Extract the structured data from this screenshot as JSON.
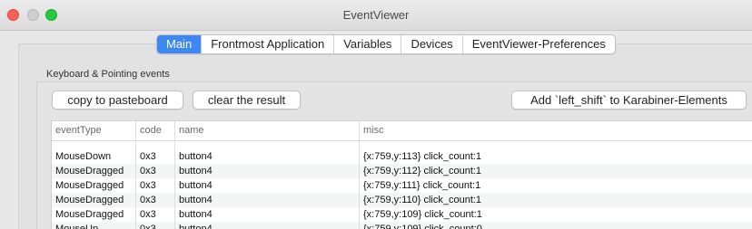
{
  "window": {
    "title": "EventViewer"
  },
  "tabs": [
    {
      "label": "Main",
      "active": true
    },
    {
      "label": "Frontmost Application",
      "active": false
    },
    {
      "label": "Variables",
      "active": false
    },
    {
      "label": "Devices",
      "active": false
    },
    {
      "label": "EventViewer-Preferences",
      "active": false
    }
  ],
  "group": {
    "label": "Keyboard & Pointing events"
  },
  "buttons": {
    "copy": "copy to pasteboard",
    "clear": "clear the result",
    "add": "Add `left_shift` to Karabiner-Elements"
  },
  "table": {
    "columns": [
      "eventType",
      "code",
      "name",
      "misc"
    ],
    "rows": [
      [
        "MouseDown",
        "0x3",
        "button4",
        "{x:759,y:113} click_count:1"
      ],
      [
        "MouseDragged",
        "0x3",
        "button4",
        "{x:759,y:112} click_count:1"
      ],
      [
        "MouseDragged",
        "0x3",
        "button4",
        "{x:759,y:111} click_count:1"
      ],
      [
        "MouseDragged",
        "0x3",
        "button4",
        "{x:759,y:110} click_count:1"
      ],
      [
        "MouseDragged",
        "0x3",
        "button4",
        "{x:759,y:109} click_count:1"
      ],
      [
        "MouseUp",
        "0x3",
        "button4",
        "{x:759,y:109} click_count:0"
      ]
    ]
  },
  "colors": {
    "accent": "#3d88f5",
    "close": "#fe5f57",
    "maximize": "#28c840"
  }
}
